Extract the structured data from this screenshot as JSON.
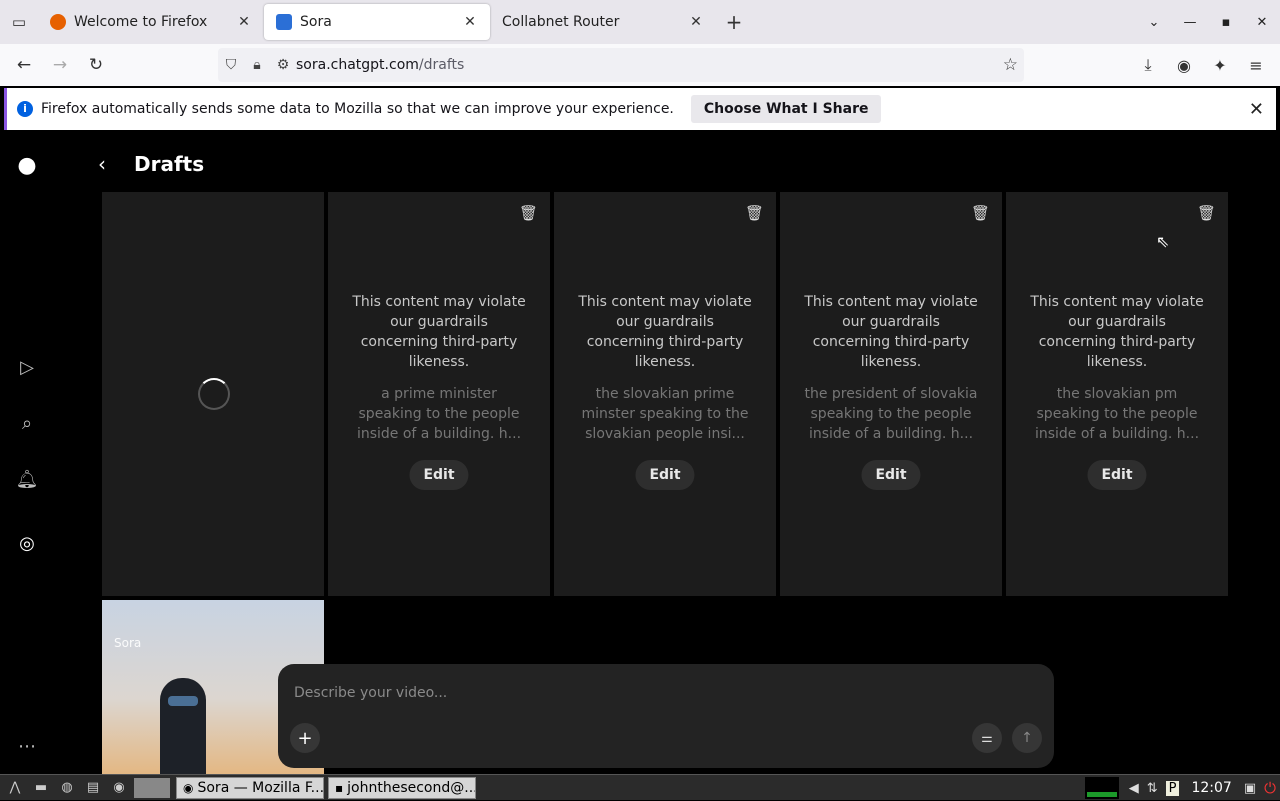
{
  "browser": {
    "tabs": [
      {
        "title": "Welcome to Firefox",
        "active": false,
        "favicon_color": "#e66000"
      },
      {
        "title": "Sora",
        "active": true,
        "favicon_color": "#2b6fd6"
      },
      {
        "title": "Collabnet Router",
        "active": false,
        "favicon_color": ""
      }
    ],
    "url_host": "sora.chatgpt.com",
    "url_path": "/drafts",
    "notification": {
      "text": "Firefox automatically sends some data to Mozilla so that we can improve your experience.",
      "button_label": "Choose What I Share"
    }
  },
  "app": {
    "page_title": "Drafts",
    "drafts": [
      {
        "state": "loading"
      },
      {
        "state": "blocked",
        "warning": "This content may violate our guardrails concerning third-party likeness.",
        "prompt": "a prime minister speaking to the people inside of a building. h...",
        "edit_label": "Edit"
      },
      {
        "state": "blocked",
        "warning": "This content may violate our guardrails concerning third-party likeness.",
        "prompt": "the slovakian prime minster speaking to the slovakian people insi...",
        "edit_label": "Edit"
      },
      {
        "state": "blocked",
        "warning": "This content may violate our guardrails concerning third-party likeness.",
        "prompt": "the president of slovakia speaking to the people inside of a building. h...",
        "edit_label": "Edit"
      },
      {
        "state": "blocked",
        "warning": "This content may violate our guardrails concerning third-party likeness.",
        "prompt": "the slovakian pm speaking to the people inside of a building. h...",
        "edit_label": "Edit"
      }
    ],
    "thumbnail_watermark": "Sora",
    "composer": {
      "placeholder": "Describe your video..."
    }
  },
  "taskbar": {
    "tasks": [
      "Sora — Mozilla F...",
      "johnthesecond@..."
    ],
    "clock": "12:07"
  }
}
